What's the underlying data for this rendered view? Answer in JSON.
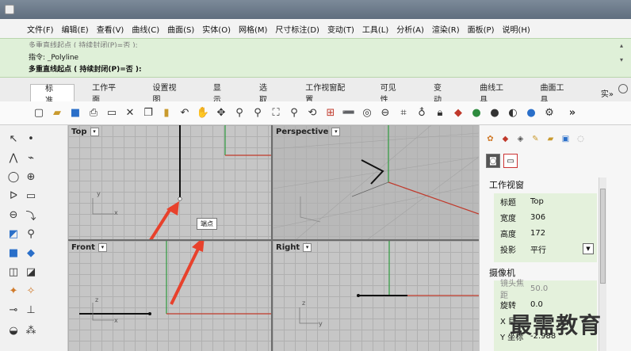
{
  "menu": [
    "文件(F)",
    "编辑(E)",
    "查看(V)",
    "曲线(C)",
    "曲面(S)",
    "实体(O)",
    "网格(M)",
    "尺寸标注(D)",
    "变动(T)",
    "工具(L)",
    "分析(A)",
    "渲染(R)",
    "面板(P)",
    "说明(H)"
  ],
  "command": {
    "history": "多重直线起点 ( 持续封闭(P)=否 ):",
    "line1": "指令: _Polyline",
    "prompt": "多重直线起点 ( 持续封闭(P)=否 ):"
  },
  "tabs": [
    "标准",
    "工作平面",
    "设置视图",
    "显示",
    "选取",
    "工作视窗配置",
    "可见性",
    "变动",
    "曲线工具",
    "曲面工具",
    "实»"
  ],
  "viewports": {
    "top": "Top",
    "perspective": "Perspective",
    "front": "Front",
    "right": "Right"
  },
  "tooltip": "端点",
  "panel": {
    "section_viewport": "工作视窗",
    "props": [
      {
        "k": "标题",
        "v": "Top"
      },
      {
        "k": "宽度",
        "v": "306"
      },
      {
        "k": "高度",
        "v": "172"
      },
      {
        "k": "投影",
        "v": "平行"
      }
    ],
    "section_camera": "摄像机",
    "camera_props": [
      {
        "k": "镜头焦距",
        "v": "50.0"
      },
      {
        "k": "旋转",
        "v": "0.0"
      },
      {
        "k": "X 目",
        "v": ""
      },
      {
        "k": "Y 坐标",
        "v": "-2.988"
      }
    ]
  },
  "watermark": "最需教育",
  "axes": {
    "x": "x",
    "y": "y",
    "z": "z"
  },
  "colors": {
    "x_axis": "#c0392b",
    "y_axis": "#2e9b3e",
    "green_panel": "#dff0d8",
    "arrow": "#e8412c"
  }
}
